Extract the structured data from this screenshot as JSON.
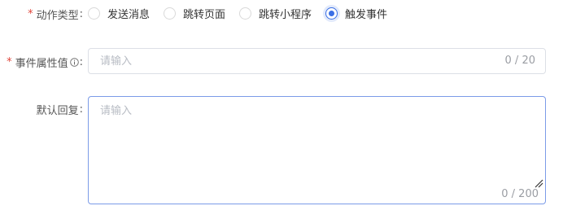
{
  "form": {
    "action_type": {
      "required_mark": "*",
      "label": "动作类型",
      "colon": ":",
      "options": [
        {
          "label": "发送消息",
          "checked": false
        },
        {
          "label": "跳转页面",
          "checked": false
        },
        {
          "label": "跳转小程序",
          "checked": false
        },
        {
          "label": "触发事件",
          "checked": true
        }
      ]
    },
    "event_attribute": {
      "required_mark": "*",
      "label": "事件属性值",
      "icon": "info-circle-icon",
      "colon": ":",
      "placeholder": "请输入",
      "value": "",
      "counter": "0 / 20"
    },
    "default_reply": {
      "label": "默认回复",
      "colon": ":",
      "placeholder": "请输入",
      "value": "",
      "counter": "0 / 200"
    }
  },
  "colors": {
    "primary": "#3b6fe5",
    "required": "#e0453a",
    "border": "#dcdfe6",
    "focus_border": "#7b9be8",
    "placeholder": "#b8bcc4"
  }
}
